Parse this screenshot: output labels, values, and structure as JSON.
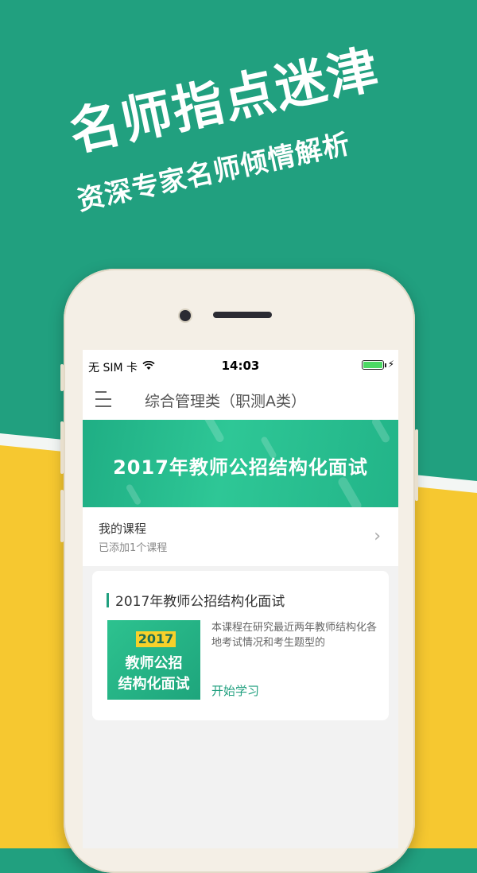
{
  "promo": {
    "title": "名师指点迷津",
    "subtitle": "资深专家名师倾情解析"
  },
  "status_bar": {
    "carrier": "无 SIM 卡",
    "time": "14:03",
    "icons": [
      "wifi-icon",
      "battery-icon",
      "charging-bolt-icon"
    ]
  },
  "nav": {
    "title": "综合管理类（职测A类）",
    "menu_icon": "hamburger-menu-icon"
  },
  "banner": {
    "text": "2017年教师公招结构化面试"
  },
  "my_course": {
    "title": "我的课程",
    "subtitle": "已添加1个课程",
    "chevron": "›"
  },
  "course_card": {
    "title": "2017年教师公招结构化面试",
    "thumb_year": "2017",
    "thumb_line1": "教师公招",
    "thumb_line2": "结构化面试",
    "description": "本课程在研究最近两年教师结构化各地考试情况和考生题型的",
    "action": "开始学习"
  },
  "colors": {
    "brand_green": "#21a07f",
    "accent_yellow": "#f6c830",
    "battery_green": "#4cd964"
  }
}
